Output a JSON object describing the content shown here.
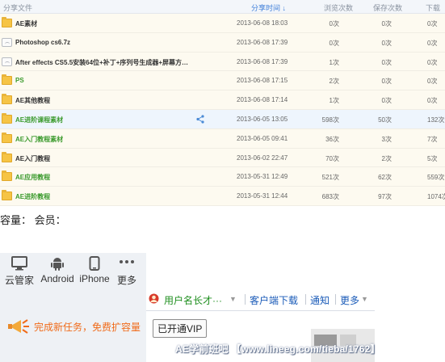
{
  "table": {
    "headers": {
      "name": "分享文件",
      "time": "分享时间 ↓",
      "views": "浏览次数",
      "saves": "保存次数",
      "downloads": "下载次"
    },
    "rows": [
      {
        "name": "AE素材",
        "type": "folder",
        "color": "dark",
        "time": "2013-06-08 18:03",
        "views": "0次",
        "saves": "0次",
        "downloads": "0次"
      },
      {
        "name": "Photoshop cs6.7z",
        "type": "file",
        "color": "dark",
        "time": "2013-06-08 17:39",
        "views": "0次",
        "saves": "0次",
        "downloads": "0次"
      },
      {
        "name": "After effects CS5.5安装64位+补丁+序列号生成器+屏幕方…",
        "type": "file",
        "color": "dark",
        "time": "2013-06-08 17:39",
        "views": "1次",
        "saves": "0次",
        "downloads": "0次"
      },
      {
        "name": "PS",
        "type": "folder",
        "color": "green",
        "time": "2013-06-08 17:15",
        "views": "2次",
        "saves": "0次",
        "downloads": "0次"
      },
      {
        "name": "AE其他教程",
        "type": "folder",
        "color": "dark",
        "time": "2013-06-08 17:14",
        "views": "1次",
        "saves": "0次",
        "downloads": "0次"
      },
      {
        "name": "AE进阶课程素材",
        "type": "folder",
        "color": "green",
        "time": "2013-06-05 13:05",
        "views": "598次",
        "saves": "50次",
        "downloads": "132次",
        "highlight": true,
        "share_icon": "share-icon"
      },
      {
        "name": "AE入门教程素材",
        "type": "folder",
        "color": "green",
        "time": "2013-06-05 09:41",
        "views": "36次",
        "saves": "3次",
        "downloads": "7次"
      },
      {
        "name": "AE入门教程",
        "type": "folder",
        "color": "dark",
        "time": "2013-06-02 22:47",
        "views": "70次",
        "saves": "2次",
        "downloads": "5次"
      },
      {
        "name": "AE应用教程",
        "type": "folder",
        "color": "green",
        "time": "2013-05-31 12:49",
        "views": "521次",
        "saves": "62次",
        "downloads": "559次"
      },
      {
        "name": "AE进阶教程",
        "type": "folder",
        "color": "green",
        "time": "2013-05-31 12:44",
        "views": "683次",
        "saves": "97次",
        "downloads": "1074次"
      }
    ]
  },
  "capacity_text": "容量： 会员：",
  "devices": [
    {
      "label": "云管家",
      "icon": "monitor-icon"
    },
    {
      "label": "Android",
      "icon": "android-icon"
    },
    {
      "label": "iPhone",
      "icon": "phone-icon"
    },
    {
      "label": "更多",
      "icon": "more-dots-icon"
    }
  ],
  "task_banner": {
    "text": "完成新任务，免费扩容量",
    "icon": "horn-icon"
  },
  "toolbar": {
    "username": "用户名长才···",
    "client_download": "客户端下载",
    "notify": "通知",
    "more": "更多"
  },
  "vip_tooltip": "已开通VIP",
  "watermark": "AE学前班吧 【www.lineeg.com/tieba/1762】",
  "colors": {
    "green_name": "#3a9a2c",
    "link_blue": "#1a5bb8",
    "orange": "#f06b1a",
    "row_bg": "#fdfaf0",
    "highlight_bg": "#eef5fd"
  }
}
